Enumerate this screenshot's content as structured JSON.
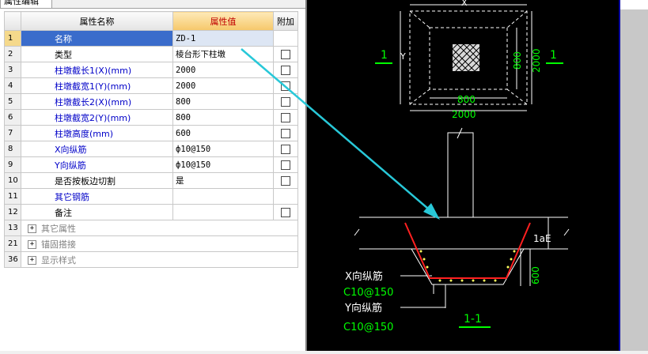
{
  "panel": {
    "tab_label": "属性编辑"
  },
  "grid": {
    "headers": {
      "name": "属性名称",
      "value": "属性值",
      "extra": "附加"
    },
    "rows": [
      {
        "num": "1",
        "name": "名称",
        "value": "ZD-1",
        "style": "sel",
        "checkbox": false
      },
      {
        "num": "2",
        "name": "类型",
        "value": "棱台形下柱墩",
        "style": "black",
        "checkbox": true
      },
      {
        "num": "3",
        "name": "柱墩截长1(X)(mm)",
        "value": "2000",
        "style": "blue",
        "checkbox": true
      },
      {
        "num": "4",
        "name": "柱墩截宽1(Y)(mm)",
        "value": "2000",
        "style": "blue",
        "checkbox": true
      },
      {
        "num": "5",
        "name": "柱墩截长2(X)(mm)",
        "value": "800",
        "style": "blue",
        "checkbox": true
      },
      {
        "num": "6",
        "name": "柱墩截宽2(Y)(mm)",
        "value": "800",
        "style": "blue",
        "checkbox": true
      },
      {
        "num": "7",
        "name": "柱墩高度(mm)",
        "value": "600",
        "style": "blue",
        "checkbox": true
      },
      {
        "num": "8",
        "name": "X向纵筋",
        "value": "ф10@150",
        "style": "blue",
        "checkbox": true
      },
      {
        "num": "9",
        "name": "Y向纵筋",
        "value": "ф10@150",
        "style": "blue",
        "checkbox": true
      },
      {
        "num": "10",
        "name": "是否按板边切割",
        "value": "是",
        "style": "black",
        "checkbox": true
      },
      {
        "num": "11",
        "name": "其它钢筋",
        "value": "",
        "style": "blue",
        "checkbox": false
      },
      {
        "num": "12",
        "name": "备注",
        "value": "",
        "style": "black",
        "checkbox": true
      },
      {
        "num": "13",
        "name": "其它属性",
        "value": "",
        "style": "group",
        "checkbox": false
      },
      {
        "num": "21",
        "name": "锚固搭接",
        "value": "",
        "style": "group",
        "checkbox": false
      },
      {
        "num": "36",
        "name": "显示样式",
        "value": "",
        "style": "group",
        "checkbox": false
      }
    ]
  },
  "drawing": {
    "plan": {
      "dim_x": "X",
      "dim_y": "Y",
      "dim_inner_width": "800",
      "dim_outer_width": "2000",
      "dim_inner_height": "800",
      "dim_outer_height": "2000",
      "section_mark_left": "1",
      "section_mark_right": "1"
    },
    "section": {
      "lae_label": "1aE",
      "height_label": "600",
      "x_rebar_label": "X向纵筋",
      "x_rebar_spec": "C10@150",
      "y_rebar_label": "Y向纵筋",
      "y_rebar_spec": "C10@150",
      "title": "1-1"
    }
  },
  "colors": {
    "selection": "#3a6ccb",
    "value_header": "#f6c86a",
    "param_text": "#0000c8",
    "cad_background": "#000000",
    "cad_lines": "#ffffff",
    "cad_dims": "#00ff00",
    "rebar": "#ff2020",
    "arrow": "#28c8d8"
  }
}
